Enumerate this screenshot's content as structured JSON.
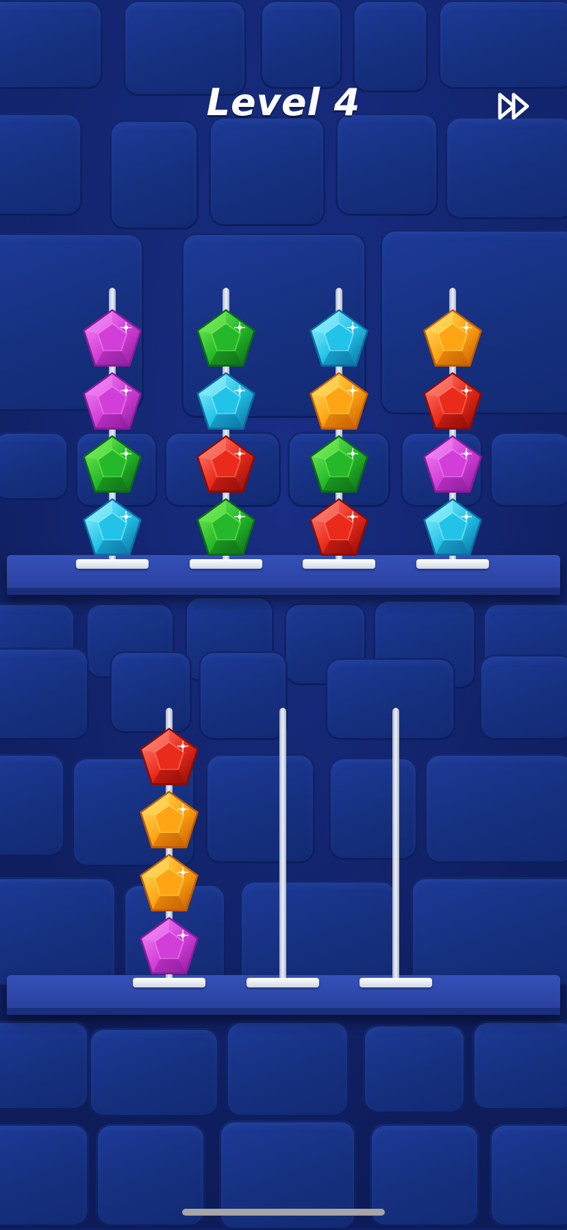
{
  "header": {
    "title": "Level 4",
    "skip_icon": "fast-forward-icon"
  },
  "palette": {
    "purple": [
      "#f58cf7",
      "#d23fd8",
      "#8a1b9a"
    ],
    "green": [
      "#7cf25a",
      "#25b82a",
      "#0d6a16"
    ],
    "cyan": [
      "#9cf4ff",
      "#22c3e8",
      "#0b6ea0"
    ],
    "orange": [
      "#ffe36a",
      "#ffa414",
      "#c25a00"
    ],
    "red": [
      "#ff8a7a",
      "#ea2a1a",
      "#8a0c06"
    ]
  },
  "shelves": [
    {
      "name": "top-shelf",
      "poles": [
        {
          "gems_top_to_bottom": [
            "purple",
            "purple",
            "green",
            "cyan"
          ]
        },
        {
          "gems_top_to_bottom": [
            "green",
            "cyan",
            "red",
            "green"
          ]
        },
        {
          "gems_top_to_bottom": [
            "cyan",
            "orange",
            "green",
            "red"
          ]
        },
        {
          "gems_top_to_bottom": [
            "orange",
            "red",
            "purple",
            "cyan"
          ]
        }
      ]
    },
    {
      "name": "bottom-shelf",
      "poles": [
        {
          "gems_top_to_bottom": [
            "red",
            "orange",
            "orange",
            "purple"
          ]
        },
        {
          "gems_top_to_bottom": []
        },
        {
          "gems_top_to_bottom": []
        }
      ]
    }
  ]
}
